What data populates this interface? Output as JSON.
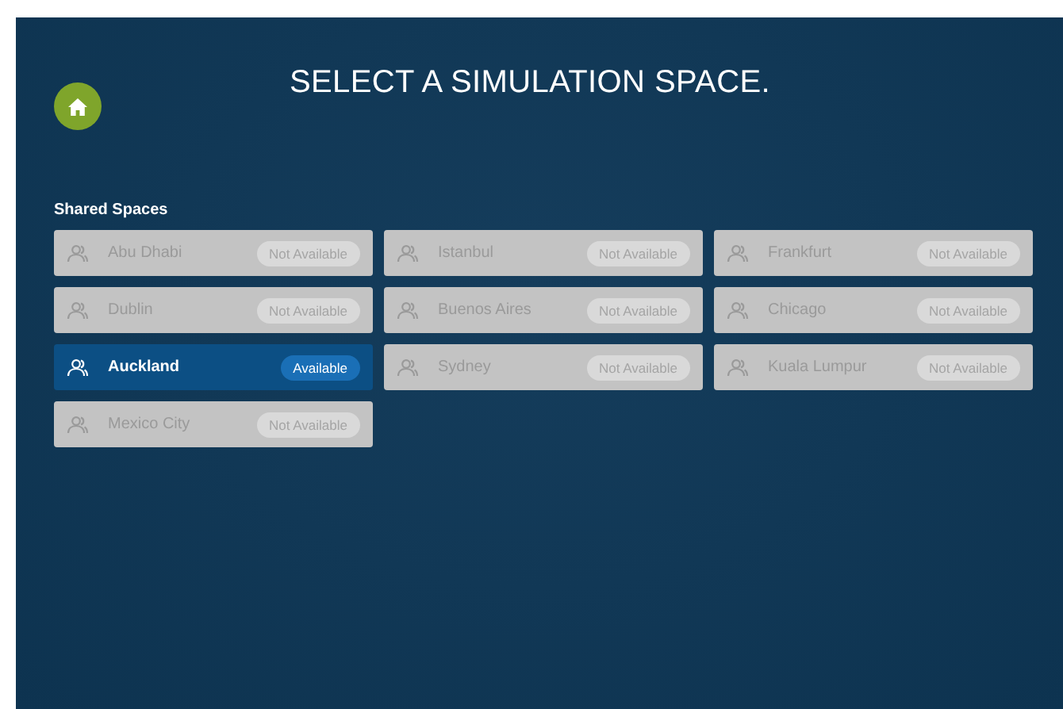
{
  "header": {
    "title": "SELECT A SIMULATION SPACE."
  },
  "section": {
    "heading": "Shared Spaces"
  },
  "spaces": [
    {
      "name": "Abu Dhabi",
      "status": "Not Available",
      "available": false
    },
    {
      "name": "Istanbul",
      "status": "Not Available",
      "available": false
    },
    {
      "name": "Frankfurt",
      "status": "Not Available",
      "available": false
    },
    {
      "name": "Dublin",
      "status": "Not Available",
      "available": false
    },
    {
      "name": "Buenos Aires",
      "status": "Not Available",
      "available": false
    },
    {
      "name": "Chicago",
      "status": "Not Available",
      "available": false
    },
    {
      "name": "Auckland",
      "status": "Available",
      "available": true
    },
    {
      "name": "Sydney",
      "status": "Not Available",
      "available": false
    },
    {
      "name": "Kuala Lumpur",
      "status": "Not Available",
      "available": false
    },
    {
      "name": "Mexico City",
      "status": "Not Available",
      "available": false
    }
  ]
}
